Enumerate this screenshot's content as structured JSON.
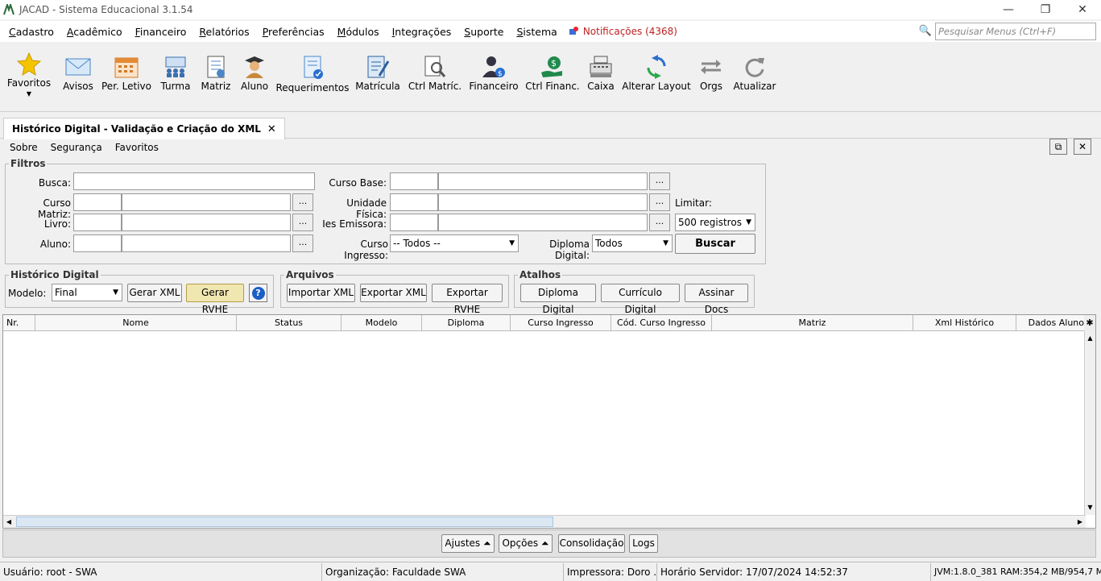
{
  "window": {
    "title": "JACAD - Sistema Educacional 3.1.54"
  },
  "menu": {
    "items": [
      "Cadastro",
      "Acadêmico",
      "Financeiro",
      "Relatórios",
      "Preferências",
      "Módulos",
      "Integrações",
      "Suporte",
      "Sistema"
    ],
    "notifications": "Notificações (4368)",
    "search_placeholder": "Pesquisar Menus (Ctrl+F)"
  },
  "toolbar": {
    "favoritos": "Favoritos",
    "avisos": "Avisos",
    "per_letivo": "Per. Letivo",
    "turma": "Turma",
    "matriz": "Matriz",
    "aluno": "Aluno",
    "requerimentos": "Requerimentos",
    "matricula": "Matrícula",
    "ctrl_matric": "Ctrl Matríc.",
    "financeiro": "Financeiro",
    "ctrl_financ": "Ctrl Financ.",
    "caixa": "Caixa",
    "alterar_layout": "Alterar Layout",
    "orgs": "Orgs",
    "atualizar": "Atualizar"
  },
  "tab": {
    "title": "Histórico Digital - Validação e Criação do XML",
    "close": "✕"
  },
  "submenu": {
    "sobre": "Sobre",
    "seguranca": "Segurança",
    "favoritos": "Favoritos"
  },
  "filtros": {
    "legend": "Filtros",
    "busca": "Busca:",
    "curso_matriz": "Curso Matriz:",
    "livro": "Livro:",
    "aluno": "Aluno:",
    "curso_base": "Curso Base:",
    "unidade_fisica": "Unidade Física:",
    "ies_emissora": "Ies Emissora:",
    "curso_ingresso": "Curso Ingresso:",
    "curso_ingresso_value": "-- Todos --",
    "diploma_digital": "Diploma Digital:",
    "diploma_digital_value": "Todos",
    "limitar": "Limitar:",
    "limitar_value": "500 registros",
    "buscar": "Buscar",
    "dots": "..."
  },
  "historico": {
    "legend": "Histórico Digital",
    "modelo": "Modelo:",
    "modelo_value": "Final",
    "gerar_xml": "Gerar XML",
    "gerar_rvhe": "Gerar RVHE",
    "help": "?"
  },
  "arquivos": {
    "legend": "Arquivos",
    "importar": "Importar XML",
    "exportar": "Exportar XML",
    "exportar_rvhe": "Exportar RVHE"
  },
  "atalhos": {
    "legend": "Atalhos",
    "diploma": "Diploma Digital",
    "curriculo": "Currículo Digital",
    "assinar": "Assinar Docs"
  },
  "grid": {
    "columns": [
      "Nr.",
      "Nome",
      "Status",
      "Modelo",
      "Diploma",
      "Curso Ingresso",
      "Cód. Curso Ingresso",
      "Matriz",
      "Xml Histórico",
      "Dados Aluno"
    ]
  },
  "bottom": {
    "ajustes": "Ajustes ⏶",
    "opcoes": "Opções ⏶",
    "consolidacao": "Consolidação",
    "logs": "Logs"
  },
  "status": {
    "usuario": "Usuário: root - SWA",
    "organizacao": "Organização: Faculdade SWA",
    "impressora": "Impressora: Doro ...",
    "horario": "Horário Servidor: 17/07/2024 14:52:37",
    "jvm": "JVM:1.8.0_381  RAM:354,2 MB/954,7 MB"
  }
}
